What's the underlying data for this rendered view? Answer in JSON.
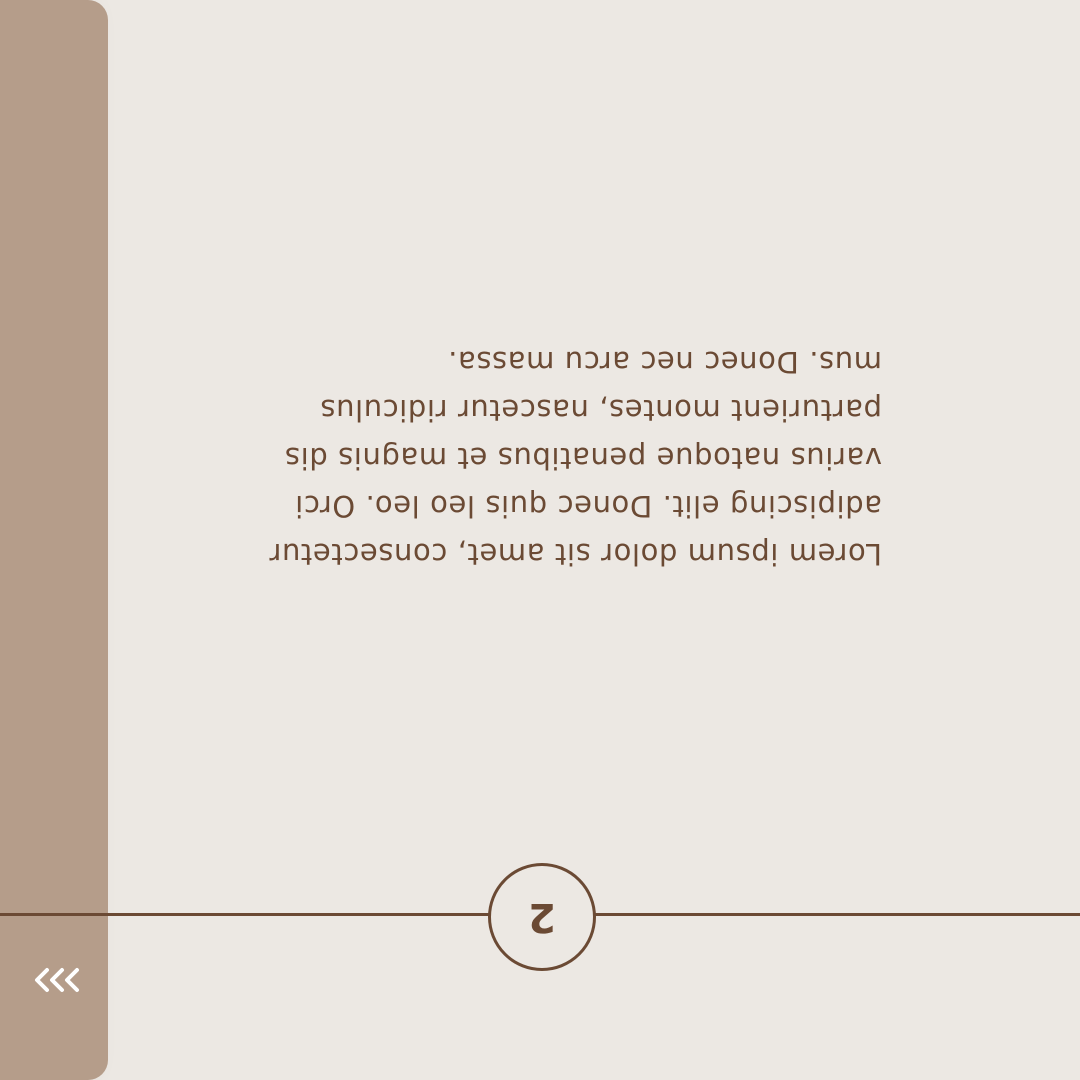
{
  "page": {
    "body_text": "Lorem ipsum dolor sit amet, consectetur\nadipiscing elit. Donec quis leo leo. Orci\nvarius natoque penatibus et magnis dis\nparturient  montes, nascetur ridiculus\nmus. Donec nec arcu massa.",
    "page_number": "2",
    "orientation": "rotated-180"
  },
  "side_tab": {
    "icon": "triple-chevron-icon"
  },
  "colors": {
    "background": "#ece8e3",
    "tab": "#b59d8a",
    "text": "#6b4a34",
    "icon": "#ffffff"
  }
}
